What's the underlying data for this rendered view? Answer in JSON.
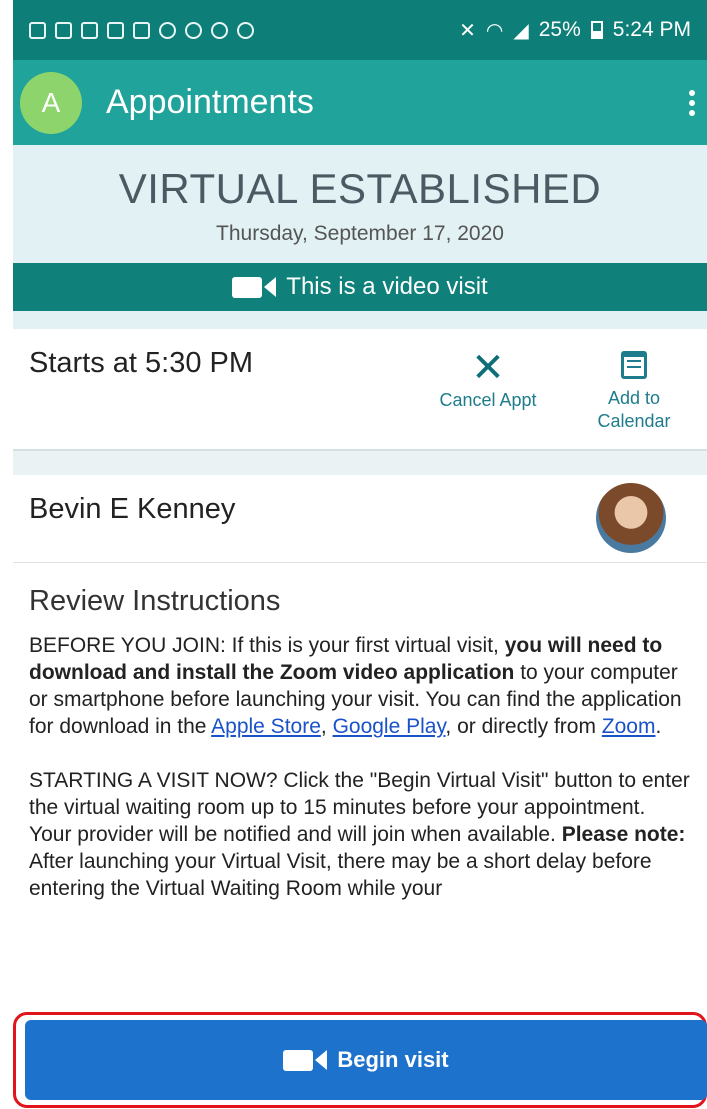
{
  "status_bar": {
    "battery": "25%",
    "time": "5:24 PM"
  },
  "app_bar": {
    "avatar_letter": "A",
    "title": "Appointments"
  },
  "visit": {
    "type": "VIRTUAL ESTABLISHED",
    "date": "Thursday, September 17, 2020",
    "video_banner": "This is a video visit"
  },
  "time_card": {
    "starts": "Starts at 5:30 PM",
    "cancel_label": "Cancel Appt",
    "add_label_line1": "Add to",
    "add_label_line2": "Calendar"
  },
  "provider": {
    "name": "Bevin E Kenney"
  },
  "instructions": {
    "title": "Review Instructions",
    "p1_a": "BEFORE YOU JOIN: If this is your first virtual visit, ",
    "p1_bold": "you will need to download and install the Zoom video application",
    "p1_b": " to your computer or smartphone before launching your visit. You can find the application for download in the ",
    "link_apple": "Apple Store",
    "sep1": ", ",
    "link_google": "Google Play",
    "p1_c": ", or directly from ",
    "link_zoom": "Zoom",
    "p1_end": ".",
    "p2_a": "STARTING A VISIT NOW? Click the \"Begin Virtual Visit\" button to enter the virtual waiting room up to 15 minutes before your appointment. Your provider will be notified and will join when available. ",
    "p2_bold": "Please note:",
    "p2_b": " After launching your Virtual Visit, there may be a short delay before entering the Virtual Waiting Room while your"
  },
  "begin_button": {
    "label": "Begin visit"
  },
  "colors": {
    "status_bar": "#0d7f78",
    "app_bar": "#1fa39a",
    "header_bg": "#e2f1f3",
    "video_banner": "#10817a",
    "action_text": "#1e7c8c",
    "link": "#1a52c9",
    "begin_button": "#1d72cc",
    "highlight_outline": "#e0141a"
  }
}
